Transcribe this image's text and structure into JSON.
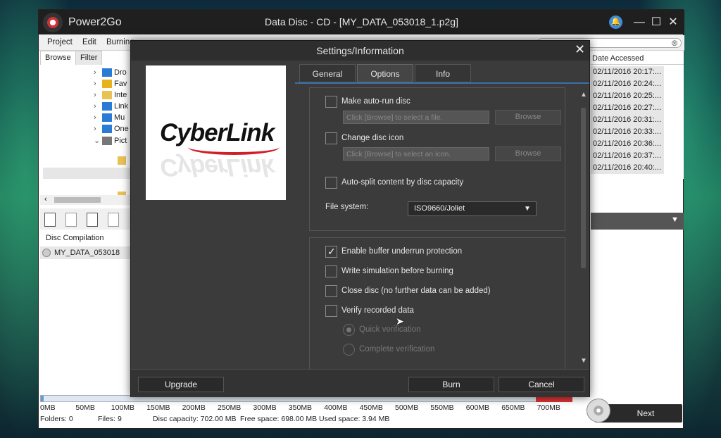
{
  "app": {
    "name": "Power2Go",
    "window_title": "Data Disc - CD - [MY_DATA_053018_1.p2g]"
  },
  "menu": [
    "Project",
    "Edit",
    "Burning"
  ],
  "left_tabs": [
    "Browse",
    "Filter"
  ],
  "tree": [
    {
      "label": "Dro",
      "icon": "dropbox-icon",
      "color": "#2a7bd6",
      "indent": 0
    },
    {
      "label": "Fav",
      "icon": "star-icon",
      "color": "#e8b21c",
      "indent": 0
    },
    {
      "label": "Inte",
      "icon": "folder-icon",
      "color": "#e8c255",
      "indent": 0
    },
    {
      "label": "Link",
      "icon": "link-icon",
      "color": "#2a7bd6",
      "indent": 0
    },
    {
      "label": "Mu",
      "icon": "music-icon",
      "color": "#2a7bd6",
      "indent": 0
    },
    {
      "label": "One",
      "icon": "cloud-icon",
      "color": "#2a7bd6",
      "indent": 0
    },
    {
      "label": "Pict",
      "icon": "picture-icon",
      "color": "#777",
      "indent": 0
    }
  ],
  "compilation": {
    "header": "Disc Compilation",
    "item": "MY_DATA_053018"
  },
  "file_list": {
    "column": "Date Accessed",
    "dates": [
      "02/11/2016 20:17:...",
      "02/11/2016 20:24:...",
      "02/11/2016 20:25:...",
      "02/11/2016 20:27:...",
      "02/11/2016 20:31:...",
      "02/11/2016 20:33:...",
      "02/11/2016 20:36:...",
      "02/11/2016 20:37:...",
      "02/11/2016 20:40:..."
    ]
  },
  "capacity_scale": [
    "0MB",
    "50MB",
    "100MB",
    "150MB",
    "200MB",
    "250MB",
    "300MB",
    "350MB",
    "400MB",
    "450MB",
    "500MB",
    "550MB",
    "600MB",
    "650MB",
    "700MB"
  ],
  "status": {
    "folders": "Folders: 0",
    "files": "Files: 9",
    "capacity": "Disc capacity: 702.00 MB",
    "free": "Free space: 698.00 MB",
    "used": "Used space: 3.94 MB"
  },
  "used_fraction": 0.0056,
  "next_label": "Next",
  "dialog": {
    "title": "Settings/Information",
    "logo_text": "CyberLink",
    "tabs": [
      "General",
      "Options",
      "Info"
    ],
    "active_tab": "Options",
    "auto_run": {
      "label": "Make auto-run disc",
      "checked": false,
      "placeholder": "Click [Browse] to select a file.",
      "browse": "Browse"
    },
    "disc_icon": {
      "label": "Change disc icon",
      "checked": false,
      "placeholder": "Click [Browse] to select an icon.",
      "browse": "Browse"
    },
    "auto_split": {
      "label": "Auto-split content by disc capacity",
      "checked": false
    },
    "file_system": {
      "label": "File system:",
      "value": "ISO9660/Joliet"
    },
    "buffer": {
      "label": "Enable buffer underrun protection",
      "checked": true
    },
    "simulation": {
      "label": "Write simulation before burning",
      "checked": false
    },
    "close_disc": {
      "label": "Close disc (no further data can be added)",
      "checked": false
    },
    "verify": {
      "label": "Verify recorded data",
      "checked": false
    },
    "quick": {
      "label": "Quick verification",
      "selected": true
    },
    "complete": {
      "label": "Complete verification",
      "selected": false
    },
    "buttons": {
      "upgrade": "Upgrade",
      "burn": "Burn",
      "cancel": "Cancel"
    }
  }
}
